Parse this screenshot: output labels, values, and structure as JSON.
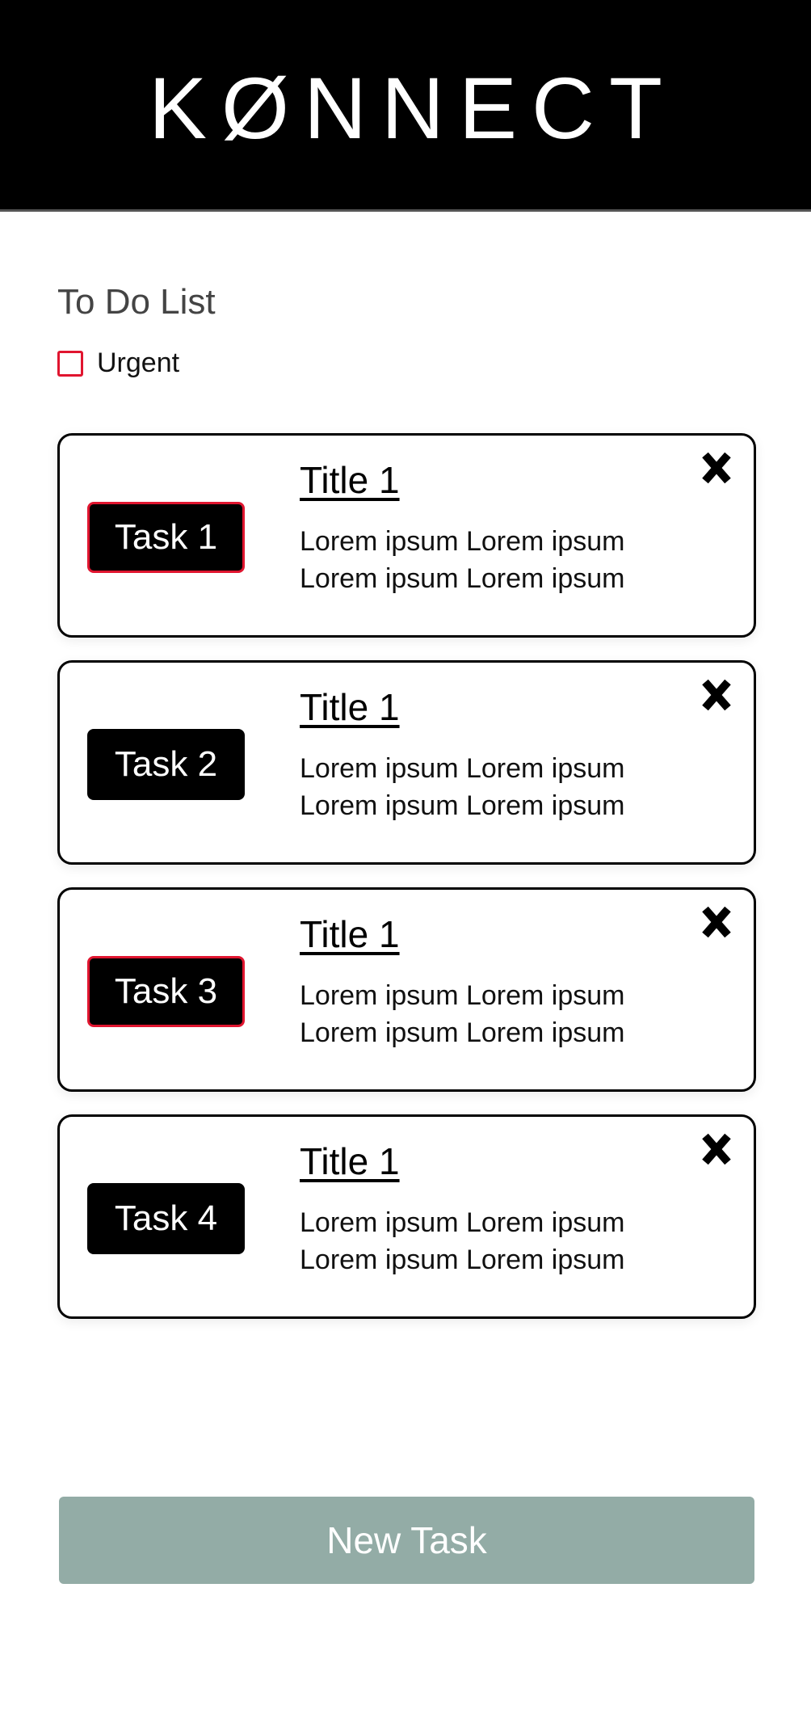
{
  "header": {
    "logo": "KØNNECT"
  },
  "list": {
    "title": "To Do List",
    "urgent_label": "Urgent"
  },
  "tasks": [
    {
      "label": "Task 1",
      "title": "Title 1",
      "description": "Lorem ipsum Lorem ipsum Lorem ipsum Lorem ipsum",
      "urgent": true
    },
    {
      "label": "Task 2",
      "title": "Title 1",
      "description": "Lorem ipsum Lorem ipsum Lorem ipsum Lorem ipsum",
      "urgent": false
    },
    {
      "label": "Task 3",
      "title": "Title 1",
      "description": "Lorem ipsum Lorem ipsum Lorem ipsum Lorem ipsum",
      "urgent": true
    },
    {
      "label": "Task 4",
      "title": "Title 1",
      "description": "Lorem ipsum Lorem ipsum Lorem ipsum Lorem ipsum",
      "urgent": false
    }
  ],
  "new_task_label": "New Task",
  "colors": {
    "header_bg": "#000000",
    "urgent_accent": "#e0152f",
    "button_bg": "#93aca6"
  },
  "icons": {
    "close": "close-icon"
  }
}
